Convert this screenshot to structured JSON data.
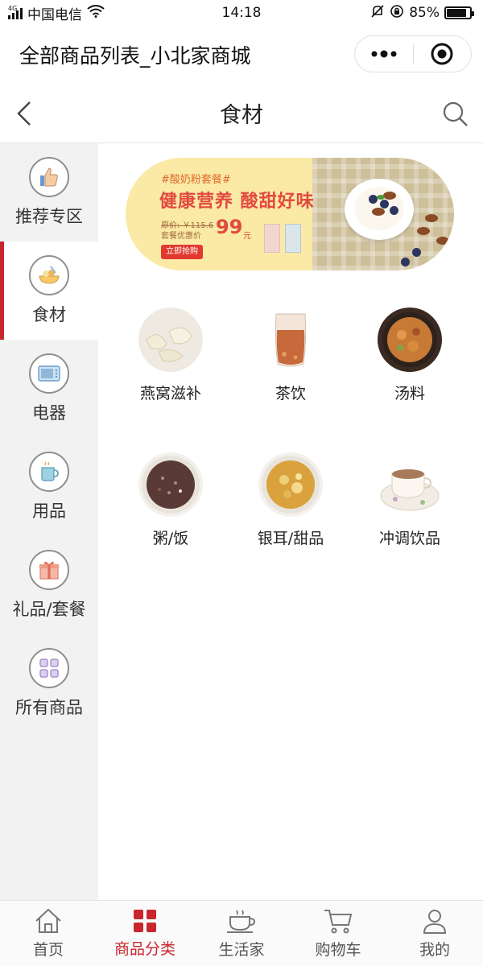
{
  "status_bar": {
    "carrier": "中国电信",
    "network": "4G",
    "time": "14:18",
    "battery": "85%",
    "battery_level": 0.85
  },
  "app": {
    "title": "全部商品列表_小北家商城"
  },
  "header": {
    "title": "食材"
  },
  "sidebar": {
    "items": [
      {
        "label": "推荐专区",
        "icon": "thumbs-up-icon",
        "active": false
      },
      {
        "label": "食材",
        "icon": "food-bowl-icon",
        "active": true
      },
      {
        "label": "电器",
        "icon": "microwave-icon",
        "active": false
      },
      {
        "label": "用品",
        "icon": "cup-icon",
        "active": false
      },
      {
        "label": "礼品/套餐",
        "icon": "gift-icon",
        "active": false
      },
      {
        "label": "所有商品",
        "icon": "grid-icon",
        "active": false
      }
    ]
  },
  "banner": {
    "tag": "#酸奶粉套餐#",
    "title": "健康营养 酸甜好味",
    "original_price": "原价: ￥115.6",
    "combo_label": "套餐优惠价",
    "price": "99",
    "unit": "元",
    "button": "立即抢购"
  },
  "categories": [
    {
      "label": "燕窝滋补",
      "icon": "birds-nest-icon"
    },
    {
      "label": "茶饮",
      "icon": "tea-glass-icon"
    },
    {
      "label": "汤料",
      "icon": "soup-pot-icon"
    },
    {
      "label": "粥/饭",
      "icon": "porridge-bowl-icon"
    },
    {
      "label": "银耳/甜品",
      "icon": "dessert-bowl-icon"
    },
    {
      "label": "冲调饮品",
      "icon": "milk-tea-icon"
    }
  ],
  "tabbar": {
    "items": [
      {
        "label": "首页",
        "icon": "home-icon",
        "active": false
      },
      {
        "label": "商品分类",
        "icon": "category-icon",
        "active": true
      },
      {
        "label": "生活家",
        "icon": "coffee-cup-icon",
        "active": false
      },
      {
        "label": "购物车",
        "icon": "cart-icon",
        "active": false
      },
      {
        "label": "我的",
        "icon": "user-icon",
        "active": false
      }
    ]
  },
  "colors": {
    "accent": "#c8272d",
    "sidebar_bg": "#f2f2f2",
    "banner_bg": "#fbe9a6"
  }
}
